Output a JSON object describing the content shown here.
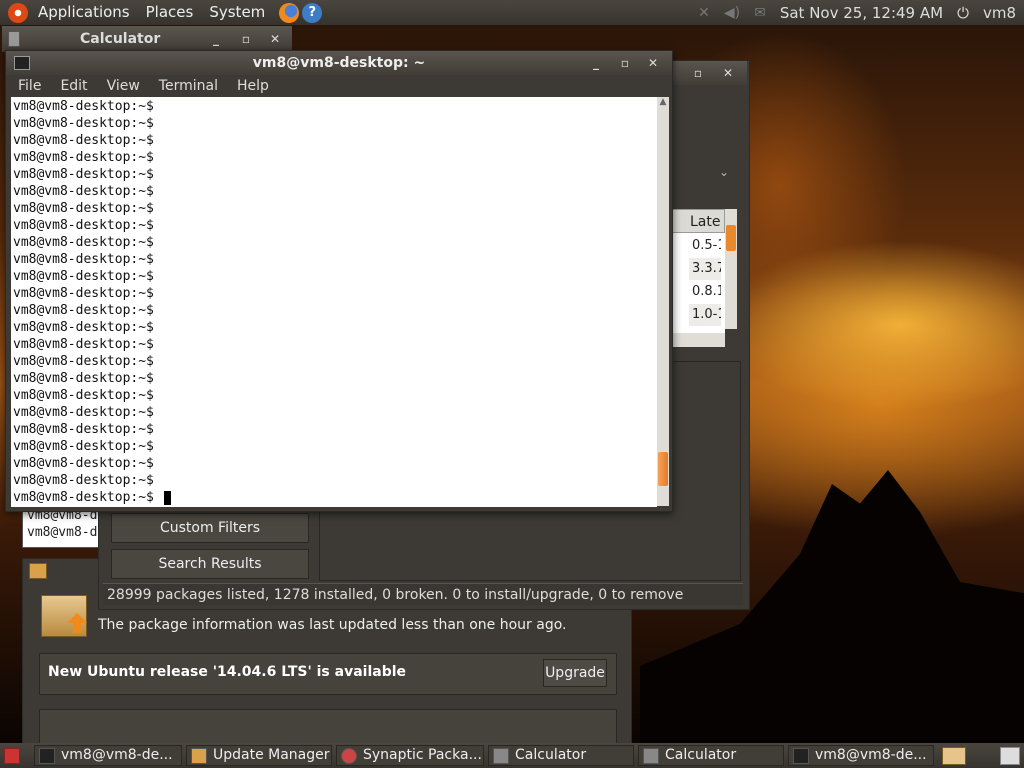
{
  "top_panel": {
    "menus": [
      "Applications",
      "Places",
      "System"
    ],
    "clock": "Sat Nov 25, 12:49 AM",
    "user": "vm8"
  },
  "calculator": {
    "title": "Calculator"
  },
  "terminal": {
    "title": "vm8@vm8-desktop: ~",
    "menus": [
      "File",
      "Edit",
      "View",
      "Terminal",
      "Help"
    ],
    "prompt": "vm8@vm8-desktop:~$",
    "scroll_position_fraction": 0.95
  },
  "background_terminal": {
    "line1": "vm8@vm8-d",
    "line2": "vm8@vm8-d"
  },
  "synaptic": {
    "column_header": "Late",
    "cells": [
      "0.5-1",
      "3.3.7",
      "0.8.1",
      "1.0-1"
    ],
    "custom_filters": "Custom Filters",
    "search_results": "Search Results",
    "status": "28999 packages listed, 1278 installed, 0 broken. 0 to install/upgrade, 0 to remove"
  },
  "update_manager": {
    "info": "The package information was last updated less than one hour ago.",
    "release": "New Ubuntu release '14.04.6 LTS' is available",
    "upgrade_button": "Upgrade"
  },
  "taskbar": {
    "tasks": [
      "vm8@vm8-de...",
      "Update Manager",
      "Synaptic Packa...",
      "Calculator",
      "Calculator",
      "vm8@vm8-de..."
    ]
  }
}
